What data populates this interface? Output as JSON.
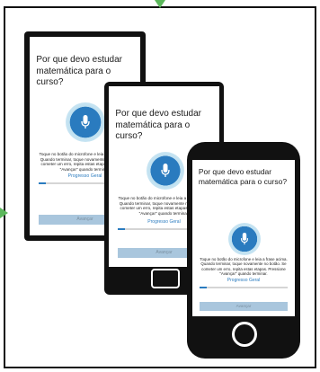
{
  "question": "Por que devo estudar matemática para o curso?",
  "instructions_short": "Toque no botão do microfone e leia a frase acima. Quando terminar, toque novamente no botão. Se cometer um erro, repita estas etapas. Pressione \"Avançar\" quando terminar.",
  "progress_label": "Progresso Geral",
  "progress_value": 0.08,
  "next_button": "Avançar",
  "colors": {
    "accent": "#2a7bbf",
    "arrow": "#5cb85c",
    "button": "#a9c6dd"
  }
}
